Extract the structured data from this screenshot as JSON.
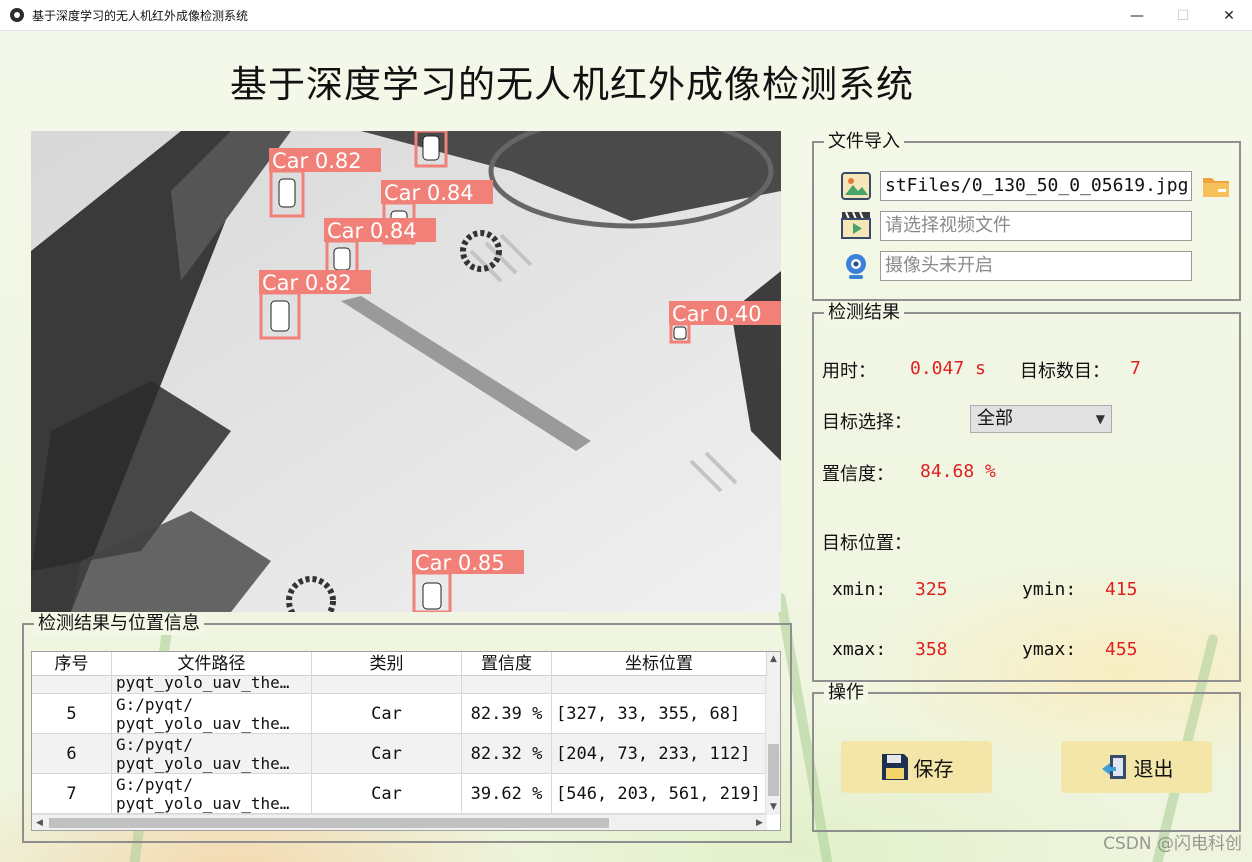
{
  "window": {
    "title": "基于深度学习的无人机红外成像检测系统",
    "controls": {
      "minimize": "—",
      "maximize": "☐",
      "close": "✕"
    }
  },
  "main_title": "基于深度学习的无人机红外成像检测系统",
  "image_panel": {
    "detections": [
      {
        "label": "Car 0.82"
      },
      {
        "label": "Car 0.84"
      },
      {
        "label": "Car 0.84"
      },
      {
        "label": "Car 0.82"
      },
      {
        "label": "Car 0.40"
      },
      {
        "label": "Car 0.85"
      }
    ]
  },
  "file_import": {
    "legend": "文件导入",
    "image_path": "stFiles/0_130_50_0_05619.jpg",
    "video_placeholder": "请选择视频文件",
    "camera_placeholder": "摄像头未开启",
    "icons": {
      "image": "image-file-icon",
      "folder": "folder-icon",
      "video": "video-file-icon",
      "camera": "webcam-icon"
    }
  },
  "results": {
    "legend": "检测结果",
    "time_label": "用时：",
    "time_value": "0.047 s",
    "count_label": "目标数目：",
    "count_value": "7",
    "select_label": "目标选择：",
    "select_value": "全部",
    "confidence_label": "置信度：",
    "confidence_value": "84.68 %",
    "position_label": "目标位置：",
    "xmin_label": "xmin:",
    "xmin_value": "325",
    "ymin_label": "ymin:",
    "ymin_value": "415",
    "xmax_label": "xmax:",
    "xmax_value": "358",
    "ymax_label": "ymax:",
    "ymax_value": "455"
  },
  "operations": {
    "legend": "操作",
    "save_label": "保存",
    "exit_label": "退出"
  },
  "table": {
    "legend": "检测结果与位置信息",
    "headers": [
      "序号",
      "文件路径",
      "类别",
      "置信度",
      "坐标位置"
    ],
    "partial_row": {
      "path": "pyqt_yolo_uav_the…"
    },
    "rows": [
      {
        "index": "5",
        "path1": "G:/pyqt/",
        "path2": "pyqt_yolo_uav_the…",
        "category": "Car",
        "confidence": "82.39 %",
        "coords": "[327, 33, 355, 68]"
      },
      {
        "index": "6",
        "path1": "G:/pyqt/",
        "path2": "pyqt_yolo_uav_the…",
        "category": "Car",
        "confidence": "82.32 %",
        "coords": "[204, 73, 233, 112]"
      },
      {
        "index": "7",
        "path1": "G:/pyqt/",
        "path2": "pyqt_yolo_uav_the…",
        "category": "Car",
        "confidence": "39.62 %",
        "coords": "[546, 203, 561, 219]"
      }
    ]
  },
  "watermark": "CSDN @闪电科创",
  "colors": {
    "value_red": "#e02020",
    "bbox": "#f08078",
    "button_bg": "#f3e6a8"
  }
}
